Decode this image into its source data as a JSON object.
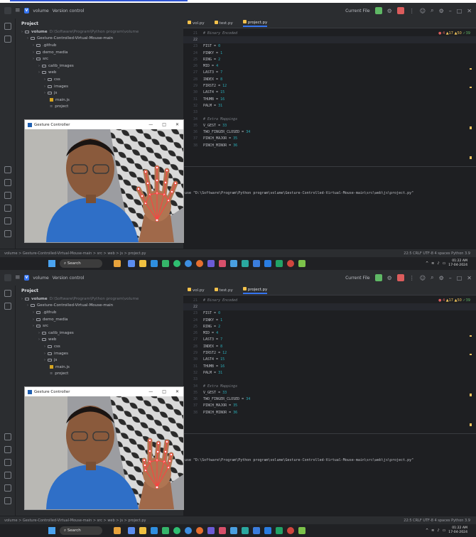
{
  "screens": [
    {
      "titlebar": {
        "project_name": "volume",
        "project_badge": "V",
        "vcs_label": "Version control",
        "run_config": "Current File"
      },
      "project_panel": {
        "header": "Project",
        "tree": [
          {
            "label": "volume",
            "path": "D:\\Software\\Program\\Python program\\volume",
            "indent": 0,
            "type": "folder"
          },
          {
            "label": "Gesture-Controlled-Virtual-Mouse-main",
            "indent": 1,
            "type": "folder"
          },
          {
            "label": ".github",
            "indent": 2,
            "type": "folder"
          },
          {
            "label": "demo_media",
            "indent": 2,
            "type": "folder"
          },
          {
            "label": "src",
            "indent": 2,
            "type": "folder"
          },
          {
            "label": "calib_images",
            "indent": 3,
            "type": "folder"
          },
          {
            "label": "web",
            "indent": 3,
            "type": "folder"
          },
          {
            "label": "css",
            "indent": 4,
            "type": "folder"
          },
          {
            "label": "images",
            "indent": 4,
            "type": "folder"
          },
          {
            "label": "js",
            "indent": 4,
            "type": "folder"
          },
          {
            "label": "main.js",
            "indent": 5,
            "type": "js"
          },
          {
            "label": "project",
            "indent": 5,
            "type": "file"
          }
        ]
      },
      "tabs": [
        {
          "label": "vol.py",
          "active": false
        },
        {
          "label": "test.py",
          "active": false
        },
        {
          "label": "project.py",
          "active": true
        }
      ],
      "inspections": {
        "errors": "4",
        "warnings": "17",
        "weak": "50",
        "ok": "39"
      },
      "code": [
        {
          "ln": "21",
          "text": "# Binary Encoded",
          "kind": "comment"
        },
        {
          "ln": "22",
          "text": "",
          "kind": "current"
        },
        {
          "ln": "23",
          "text": "FIST = 0",
          "kind": "code"
        },
        {
          "ln": "24",
          "text": "PINKY = 1",
          "kind": "code"
        },
        {
          "ln": "25",
          "text": "RING = 2",
          "kind": "code"
        },
        {
          "ln": "26",
          "text": "MID = 4",
          "kind": "code"
        },
        {
          "ln": "27",
          "text": "LAST3 = 7",
          "kind": "code"
        },
        {
          "ln": "28",
          "text": "INDEX = 8",
          "kind": "code"
        },
        {
          "ln": "29",
          "text": "FIRST2 = 12",
          "kind": "code"
        },
        {
          "ln": "30",
          "text": "LAST4 = 15",
          "kind": "code"
        },
        {
          "ln": "31",
          "text": "THUMB = 16",
          "kind": "code"
        },
        {
          "ln": "32",
          "text": "PALM = 31",
          "kind": "code"
        },
        {
          "ln": "33",
          "text": "",
          "kind": "code"
        },
        {
          "ln": "34",
          "text": "# Extra Mappings",
          "kind": "comment"
        },
        {
          "ln": "35",
          "text": "V_GEST = 33",
          "kind": "code"
        },
        {
          "ln": "36",
          "text": "TWO_FINGER_CLOSED = 34",
          "kind": "code"
        },
        {
          "ln": "37",
          "text": "PINCH_MAJOR = 35",
          "kind": "code"
        },
        {
          "ln": "38",
          "text": "PINCH_MINOR = 36",
          "kind": "code"
        }
      ],
      "run_output": "use \"D:\\Software\\Program\\Python program\\volume\\Gesture-Controlled-Virtual-Mouse-main\\src\\web\\js\\project.py\"",
      "camera_window": {
        "title": "Gesture Controller",
        "hand_pose": "open"
      },
      "statusbar": {
        "breadcrumb": "volume > Gesture-Controlled-Virtual-Mouse-main > src > web > js > project.py",
        "right": "22:5   CRLF   UTF-8   4 spaces   Python 3.9"
      },
      "taskbar": {
        "search_label": "Search",
        "time": "01:22 AM",
        "date": "17-04-2024"
      }
    },
    {
      "titlebar": {
        "project_name": "volume",
        "project_badge": "V",
        "vcs_label": "Version control",
        "run_config": "Current File"
      },
      "project_panel": {
        "header": "Project",
        "tree": [
          {
            "label": "volume",
            "path": "D:\\Software\\Program\\Python program\\volume",
            "indent": 0,
            "type": "folder"
          },
          {
            "label": "Gesture-Controlled-Virtual-Mouse-main",
            "indent": 1,
            "type": "folder"
          },
          {
            "label": ".github",
            "indent": 2,
            "type": "folder"
          },
          {
            "label": "demo_media",
            "indent": 2,
            "type": "folder"
          },
          {
            "label": "src",
            "indent": 2,
            "type": "folder"
          },
          {
            "label": "calib_images",
            "indent": 3,
            "type": "folder"
          },
          {
            "label": "web",
            "indent": 3,
            "type": "folder"
          },
          {
            "label": "css",
            "indent": 4,
            "type": "folder"
          },
          {
            "label": "images",
            "indent": 4,
            "type": "folder"
          },
          {
            "label": "js",
            "indent": 4,
            "type": "folder"
          },
          {
            "label": "main.js",
            "indent": 5,
            "type": "js"
          },
          {
            "label": "project",
            "indent": 5,
            "type": "file"
          }
        ]
      },
      "tabs": [
        {
          "label": "vol.py",
          "active": false
        },
        {
          "label": "test.py",
          "active": false
        },
        {
          "label": "project.py",
          "active": true
        }
      ],
      "inspections": {
        "errors": "4",
        "warnings": "17",
        "weak": "50",
        "ok": "39"
      },
      "code": [
        {
          "ln": "21",
          "text": "# Binary Encoded",
          "kind": "comment"
        },
        {
          "ln": "22",
          "text": "",
          "kind": "current"
        },
        {
          "ln": "23",
          "text": "FIST = 0",
          "kind": "code"
        },
        {
          "ln": "24",
          "text": "PINKY = 1",
          "kind": "code"
        },
        {
          "ln": "25",
          "text": "RING = 2",
          "kind": "code"
        },
        {
          "ln": "26",
          "text": "MID = 4",
          "kind": "code"
        },
        {
          "ln": "27",
          "text": "LAST3 = 7",
          "kind": "code"
        },
        {
          "ln": "28",
          "text": "INDEX = 8",
          "kind": "code"
        },
        {
          "ln": "29",
          "text": "FIRST2 = 12",
          "kind": "code"
        },
        {
          "ln": "30",
          "text": "LAST4 = 15",
          "kind": "code"
        },
        {
          "ln": "31",
          "text": "THUMB = 16",
          "kind": "code"
        },
        {
          "ln": "32",
          "text": "PALM = 31",
          "kind": "code"
        },
        {
          "ln": "33",
          "text": "",
          "kind": "code"
        },
        {
          "ln": "34",
          "text": "# Extra Mappings",
          "kind": "comment"
        },
        {
          "ln": "35",
          "text": "V_GEST = 33",
          "kind": "code"
        },
        {
          "ln": "36",
          "text": "TWO_FINGER_CLOSED = 34",
          "kind": "code"
        },
        {
          "ln": "37",
          "text": "PINCH_MAJOR = 35",
          "kind": "code"
        },
        {
          "ln": "38",
          "text": "PINCH_MINOR = 36",
          "kind": "code"
        }
      ],
      "run_output": "use \"D:\\Software\\Program\\Python program\\volume\\Gesture-Controlled-Virtual-Mouse-main\\src\\web\\js\\project.py\"",
      "camera_window": {
        "title": "Gesture Controller",
        "hand_pose": "pinch"
      },
      "statusbar": {
        "breadcrumb": "volume > Gesture-Controlled-Virtual-Mouse-main > src > web > js > project.py",
        "right": "22:5   CRLF   UTF-8   4 spaces   Python 3.9"
      },
      "taskbar": {
        "search_label": "Search",
        "time": "01:22 AM",
        "date": "17-04-2024"
      }
    }
  ],
  "colors": {
    "ide_bg": "#1e1f22",
    "panel_bg": "#2b2d30",
    "accent": "#3574f0",
    "comment": "#7a7e85",
    "hand_landmarks": "#ff4040"
  }
}
